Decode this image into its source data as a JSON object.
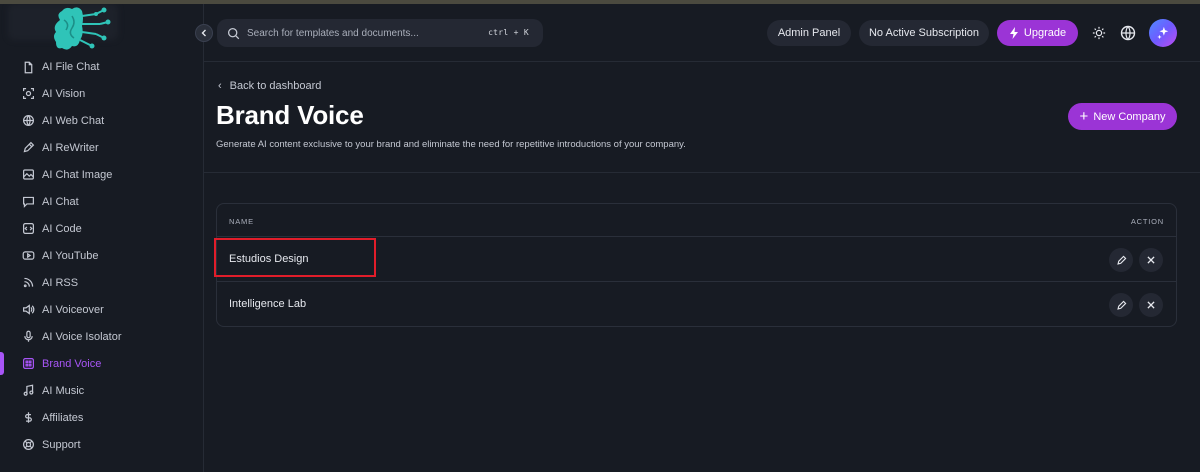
{
  "sidebar": {
    "items": [
      {
        "label": "AI File Chat",
        "icon": "file-icon"
      },
      {
        "label": "AI Vision",
        "icon": "scan-icon"
      },
      {
        "label": "AI Web Chat",
        "icon": "globe-icon"
      },
      {
        "label": "AI ReWriter",
        "icon": "pen-icon"
      },
      {
        "label": "AI Chat Image",
        "icon": "image-icon"
      },
      {
        "label": "AI Chat",
        "icon": "chat-icon"
      },
      {
        "label": "AI Code",
        "icon": "code-icon"
      },
      {
        "label": "AI YouTube",
        "icon": "youtube-icon"
      },
      {
        "label": "AI RSS",
        "icon": "rss-icon"
      },
      {
        "label": "AI Voiceover",
        "icon": "speaker-icon"
      },
      {
        "label": "AI Voice Isolator",
        "icon": "mic-icon"
      },
      {
        "label": "Brand Voice",
        "icon": "brand-icon",
        "active": true
      },
      {
        "label": "AI Music",
        "icon": "music-icon"
      },
      {
        "label": "Affiliates",
        "icon": "dollar-icon"
      },
      {
        "label": "Support",
        "icon": "lifebuoy-icon"
      }
    ]
  },
  "header": {
    "search_placeholder": "Search for templates and documents...",
    "shortcut": "ctrl + K",
    "admin_panel": "Admin Panel",
    "subscription": "No Active Subscription",
    "upgrade": "Upgrade"
  },
  "page": {
    "back": "Back to dashboard",
    "title": "Brand Voice",
    "subtitle": "Generate AI content exclusive to your brand and eliminate the need for repetitive introductions of your company.",
    "new_company": "New Company"
  },
  "table": {
    "col_name": "NAME",
    "col_action": "ACTION",
    "rows": [
      {
        "name": "Estudios Design"
      },
      {
        "name": "Intelligence Lab"
      }
    ]
  },
  "colors": {
    "accent": "#9b34d6",
    "active": "#a855f7",
    "highlight": "#e11d2a"
  }
}
